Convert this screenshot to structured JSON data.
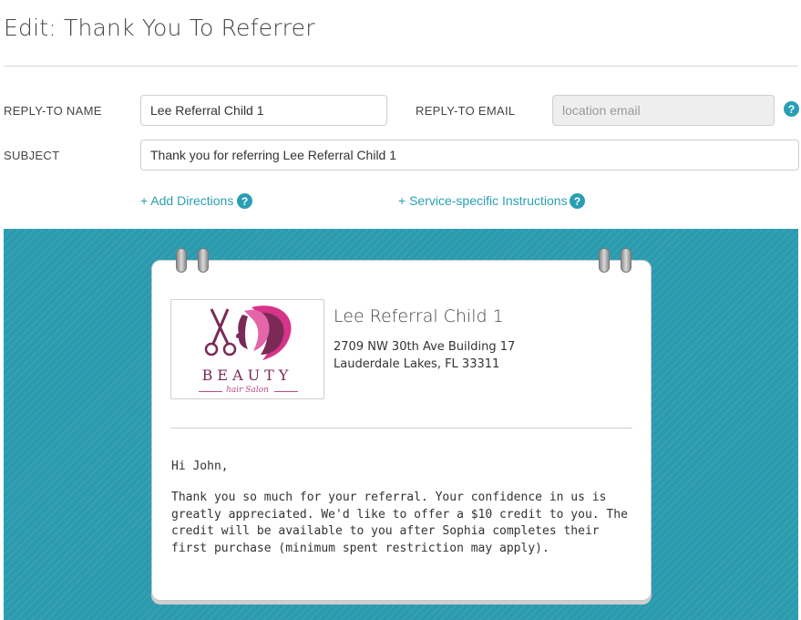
{
  "page": {
    "title": "Edit: Thank You To Referrer"
  },
  "form": {
    "reply_to_name_label": "REPLY-TO NAME",
    "reply_to_name_value": "Lee Referral Child 1",
    "reply_to_email_label": "REPLY-TO EMAIL",
    "reply_to_email_placeholder": "location email",
    "subject_label": "SUBJECT",
    "subject_value": "Thank you for referring Lee Referral Child 1"
  },
  "links": {
    "add_directions": "+ Add Directions",
    "service_instructions": "+ Service-specific Instructions"
  },
  "help_glyph": "?",
  "preview": {
    "logo_title": "BEAUTY",
    "logo_subtitle": "hair Salon",
    "business_name": "Lee Referral Child 1",
    "address_line1": "2709 NW 30th Ave Building 17",
    "address_line2": "Lauderdale Lakes, FL 33311",
    "greeting": "Hi John,",
    "body": "Thank you so much for your referral. Your confidence in us is greatly appreciated. We'd like to offer a $10 credit to you. The credit will be available to you after Sophia completes their first purchase (minimum spent restriction may apply)."
  },
  "colors": {
    "accent": "#2a9fb3",
    "preview_background": "#2b9aae",
    "logo_magenta": "#d6338a",
    "logo_purple": "#7a2a55"
  },
  "icons": {
    "help": "help-circle-icon",
    "logo": "beauty-salon-logo"
  }
}
